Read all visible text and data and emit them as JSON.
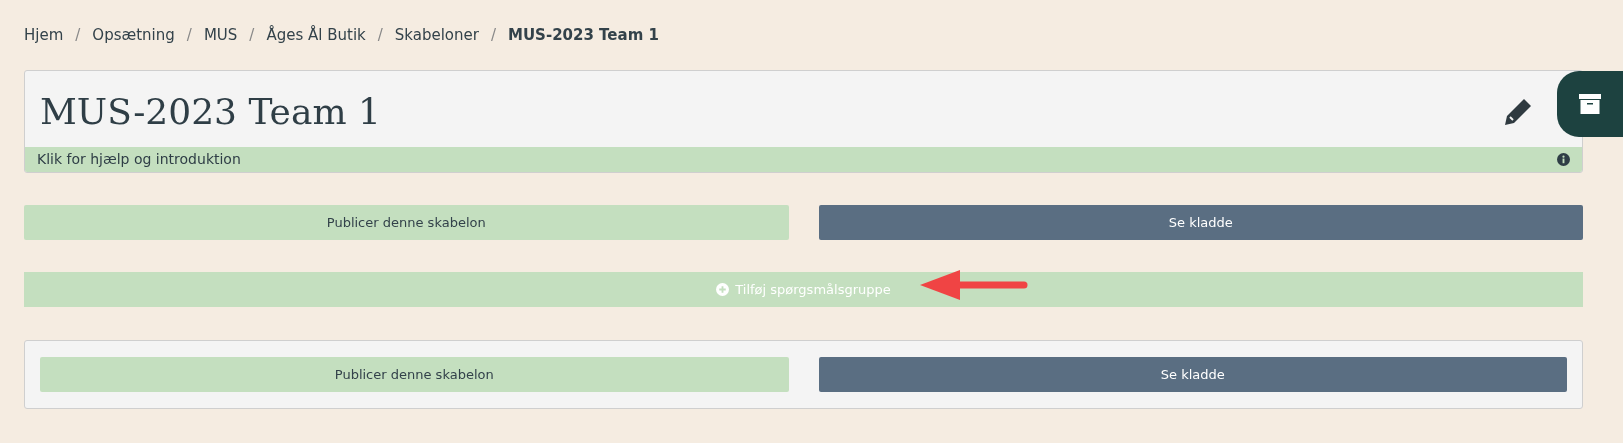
{
  "breadcrumb": [
    {
      "label": "Hjem",
      "current": false
    },
    {
      "separator": "/",
      "label": "Opsætning",
      "current": false
    },
    {
      "separator": "/",
      "label": "MUS",
      "current": false
    },
    {
      "separator": "/",
      "label": "Åges Ål Butik",
      "current": false
    },
    {
      "separator": "/",
      "label": "Skabeloner",
      "current": false
    },
    {
      "separator": "/",
      "label": "MUS-2023 Team 1",
      "current": true
    }
  ],
  "title": "MUS-2023 Team 1",
  "help_text": "Klik for hjælp og introduktion",
  "top_actions": {
    "publish": "Publicer denne skabelon",
    "preview": "Se kladde"
  },
  "add_group": "Tilføj spørgsmålsgruppe",
  "bottom_actions": {
    "publish": "Publicer denne skabelon",
    "preview": "Se kladde"
  }
}
